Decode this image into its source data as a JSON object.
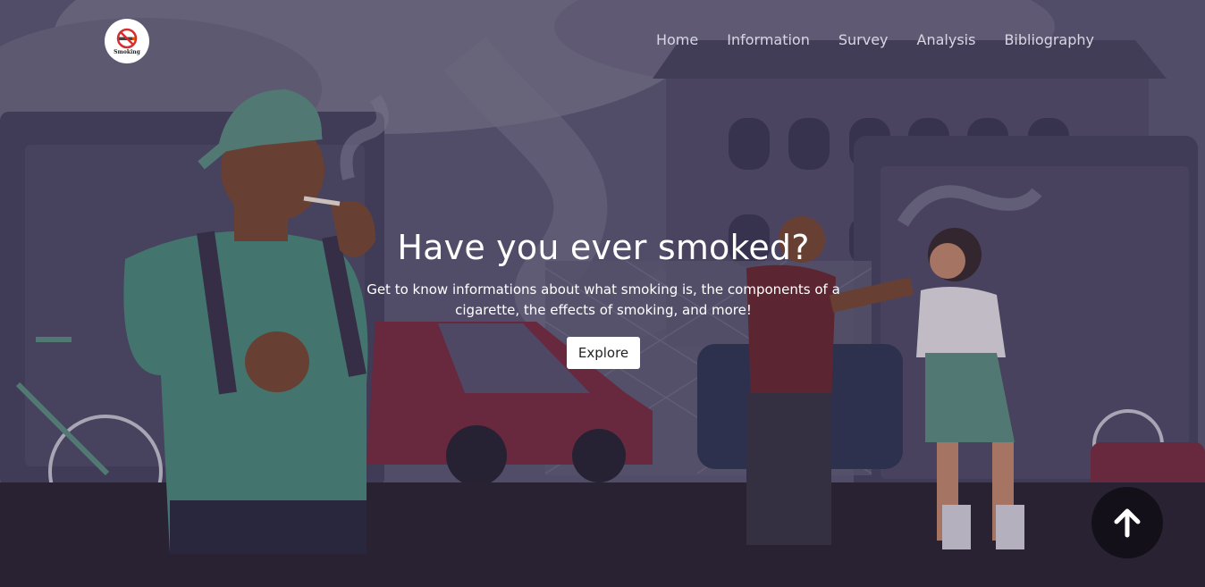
{
  "brand": {
    "logo_text": "Smoking",
    "logo_icon": "no-smoking-icon"
  },
  "nav": {
    "items": [
      {
        "label": "Home"
      },
      {
        "label": "Information"
      },
      {
        "label": "Survey"
      },
      {
        "label": "Analysis"
      },
      {
        "label": "Bibliography"
      }
    ]
  },
  "hero": {
    "title": "Have you ever smoked?",
    "subtitle": "Get to know informations about what smoking is, the components of a cigarette, the effects of smoking, and more!",
    "button_label": "Explore",
    "background_image": "illustration of people smoking in a city street"
  },
  "scroll_top": {
    "icon": "arrow-up-icon"
  },
  "colors": {
    "accent": "#ffffff",
    "nav_text": "#d9d6e4",
    "background": "#4f4a68",
    "scroll_button": "#131019"
  }
}
